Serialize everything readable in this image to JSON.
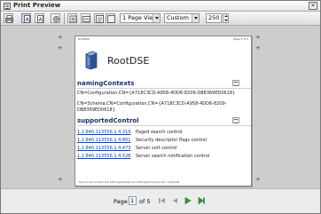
{
  "window": {
    "title": "Print Preview",
    "close_glyph": "×"
  },
  "toolbar": {
    "buttons": [
      "print-icon",
      "single-page-icon",
      "two-page-icon",
      "page-setup-icon",
      "full-page-icon",
      "page-width-icon",
      "text-width-icon",
      "first-page-icon"
    ],
    "view_select": "1 Page View",
    "zoom_select": "Custom",
    "zoom_value": "250"
  },
  "page": {
    "header_left": "RootDSE",
    "header_right": "Page 1 of 5",
    "title": "RootDSE",
    "sections": {
      "naming_contexts": {
        "heading": "namingContexts",
        "values": [
          "CN=Configuration,CN={A718C3CD-A958-4DD6-8209-DB8369ED0618}",
          "CN=Schema,CN=Configuration,CN={A718C3CD-A958-4DD6-8209-DB8369ED0618}"
        ]
      },
      "supported_control": {
        "heading": "supportedControl",
        "rows": [
          {
            "oid": "1.2.840.113556.1.4.319",
            "desc": "Paged search control"
          },
          {
            "oid": "1.2.840.113556.1.4.801",
            "desc": "Security descriptor flags control"
          },
          {
            "oid": "1.2.840.113556.1.4.473",
            "desc": "Server sort control"
          },
          {
            "oid": "1.2.840.113556.1.4.528",
            "desc": "Server search notification control"
          }
        ]
      }
    },
    "footer": "file:///C:/Documents and Settings/ADAM/Local Settings/Temp/rgc2.htm    7/16/2005"
  },
  "statusbar": {
    "page_label": "Page",
    "page_value": "1",
    "of_label": "of 5"
  },
  "colors": {
    "heading": "#1c2f6b",
    "link": "#1a3bb0",
    "nav_active": "#2c9a3c",
    "nav_disabled": "#9a9a9a"
  }
}
